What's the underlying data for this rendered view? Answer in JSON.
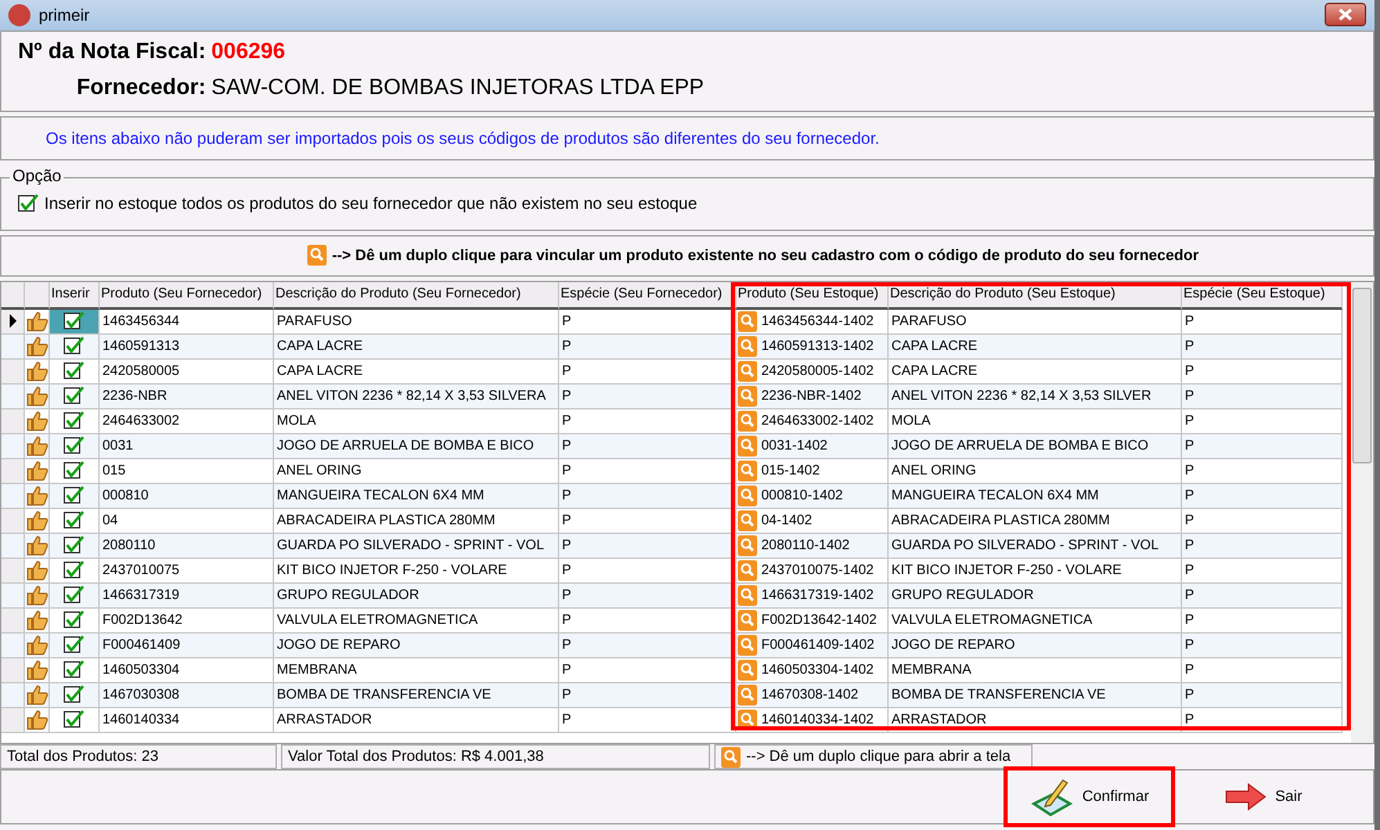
{
  "window": {
    "title": "primeir"
  },
  "header": {
    "nota_label": "Nº da Nota Fiscal:",
    "nota_value": "006296",
    "fornecedor_label": "Fornecedor:",
    "fornecedor_value": "SAW-COM. DE BOMBAS INJETORAS LTDA EPP"
  },
  "message": "Os itens abaixo não puderam ser importados pois os seus códigos de produtos são diferentes do seu fornecedor.",
  "option_group": {
    "title": "Opção",
    "label": "Inserir no estoque todos os produtos do seu fornecedor que não existem no seu estoque",
    "checked": true
  },
  "hint": "--> Dê um duplo clique para vincular um produto existente no seu cadastro com o código de produto do seu fornecedor",
  "table": {
    "columns": [
      "Inserir",
      "Produto (Seu Fornecedor)",
      "Descrição do Produto (Seu Fornecedor)",
      "Espécie (Seu Fornecedor)",
      "Produto (Seu Estoque)",
      "Descrição do Produto (Seu Estoque)",
      "Espécie (Seu Estoque)"
    ],
    "rows": [
      {
        "selected": true,
        "inserir": true,
        "codigo": "1463456344",
        "descricao": "PARAFUSO",
        "especie": "P",
        "codigo_estoque": "1463456344-1402",
        "descricao_estoque": "PARAFUSO",
        "especie_estoque": "P"
      },
      {
        "selected": false,
        "inserir": true,
        "codigo": "1460591313",
        "descricao": "CAPA LACRE",
        "especie": "P",
        "codigo_estoque": "1460591313-1402",
        "descricao_estoque": "CAPA LACRE",
        "especie_estoque": "P"
      },
      {
        "selected": false,
        "inserir": true,
        "codigo": "2420580005",
        "descricao": "CAPA LACRE",
        "especie": "P",
        "codigo_estoque": "2420580005-1402",
        "descricao_estoque": "CAPA LACRE",
        "especie_estoque": "P"
      },
      {
        "selected": false,
        "inserir": true,
        "codigo": "2236-NBR",
        "descricao": "ANEL VITON 2236 * 82,14 X 3,53 SILVERA",
        "especie": "P",
        "codigo_estoque": "2236-NBR-1402",
        "descricao_estoque": "ANEL VITON 2236 * 82,14 X 3,53 SILVER",
        "especie_estoque": "P"
      },
      {
        "selected": false,
        "inserir": true,
        "codigo": "2464633002",
        "descricao": "MOLA",
        "especie": "P",
        "codigo_estoque": "2464633002-1402",
        "descricao_estoque": "MOLA",
        "especie_estoque": "P"
      },
      {
        "selected": false,
        "inserir": true,
        "codigo": "0031",
        "descricao": "JOGO DE ARRUELA DE BOMBA E BICO",
        "especie": "P",
        "codigo_estoque": "0031-1402",
        "descricao_estoque": "JOGO DE ARRUELA DE BOMBA E BICO",
        "especie_estoque": "P"
      },
      {
        "selected": false,
        "inserir": true,
        "codigo": "015",
        "descricao": "ANEL ORING",
        "especie": "P",
        "codigo_estoque": "015-1402",
        "descricao_estoque": "ANEL ORING",
        "especie_estoque": "P"
      },
      {
        "selected": false,
        "inserir": true,
        "codigo": "000810",
        "descricao": "MANGUEIRA TECALON 6X4 MM",
        "especie": "P",
        "codigo_estoque": "000810-1402",
        "descricao_estoque": "MANGUEIRA TECALON 6X4 MM",
        "especie_estoque": "P"
      },
      {
        "selected": false,
        "inserir": true,
        "codigo": "04",
        "descricao": "ABRACADEIRA PLASTICA 280MM",
        "especie": "P",
        "codigo_estoque": "04-1402",
        "descricao_estoque": "ABRACADEIRA PLASTICA 280MM",
        "especie_estoque": "P"
      },
      {
        "selected": false,
        "inserir": true,
        "codigo": "2080110",
        "descricao": "GUARDA PO SILVERADO - SPRINT - VOL",
        "especie": "P",
        "codigo_estoque": "2080110-1402",
        "descricao_estoque": "GUARDA PO SILVERADO - SPRINT - VOL",
        "especie_estoque": "P"
      },
      {
        "selected": false,
        "inserir": true,
        "codigo": "2437010075",
        "descricao": "KIT BICO INJETOR F-250 - VOLARE",
        "especie": "P",
        "codigo_estoque": "2437010075-1402",
        "descricao_estoque": "KIT BICO INJETOR F-250 - VOLARE",
        "especie_estoque": "P"
      },
      {
        "selected": false,
        "inserir": true,
        "codigo": "1466317319",
        "descricao": "GRUPO REGULADOR",
        "especie": "P",
        "codigo_estoque": "1466317319-1402",
        "descricao_estoque": "GRUPO REGULADOR",
        "especie_estoque": "P"
      },
      {
        "selected": false,
        "inserir": true,
        "codigo": "F002D13642",
        "descricao": "VALVULA ELETROMAGNETICA",
        "especie": "P",
        "codigo_estoque": "F002D13642-1402",
        "descricao_estoque": "VALVULA ELETROMAGNETICA",
        "especie_estoque": "P"
      },
      {
        "selected": false,
        "inserir": true,
        "codigo": "F000461409",
        "descricao": "JOGO DE REPARO",
        "especie": "P",
        "codigo_estoque": "F000461409-1402",
        "descricao_estoque": "JOGO DE REPARO",
        "especie_estoque": "P"
      },
      {
        "selected": false,
        "inserir": true,
        "codigo": "1460503304",
        "descricao": "MEMBRANA",
        "especie": "P",
        "codigo_estoque": "1460503304-1402",
        "descricao_estoque": "MEMBRANA",
        "especie_estoque": "P"
      },
      {
        "selected": false,
        "inserir": true,
        "codigo": "1467030308",
        "descricao": "BOMBA DE TRANSFERENCIA VE",
        "especie": "P",
        "codigo_estoque": "14670308-1402",
        "descricao_estoque": "BOMBA DE TRANSFERENCIA VE",
        "especie_estoque": "P"
      },
      {
        "selected": false,
        "inserir": true,
        "codigo": "1460140334",
        "descricao": "ARRASTADOR",
        "especie": "P",
        "codigo_estoque": "1460140334-1402",
        "descricao_estoque": "ARRASTADOR",
        "especie_estoque": "P"
      }
    ]
  },
  "status_bar": {
    "total": "Total dos Produtos: 23",
    "valor": "Valor Total dos Produtos: R$ 4.001,38",
    "hint": "--> Dê um duplo clique para abrir a tela"
  },
  "buttons": [
    {
      "kind": "confirm",
      "label": "Confirmar",
      "highlighted": true
    },
    {
      "kind": "exit",
      "label": "Sair",
      "highlighted": false
    }
  ]
}
